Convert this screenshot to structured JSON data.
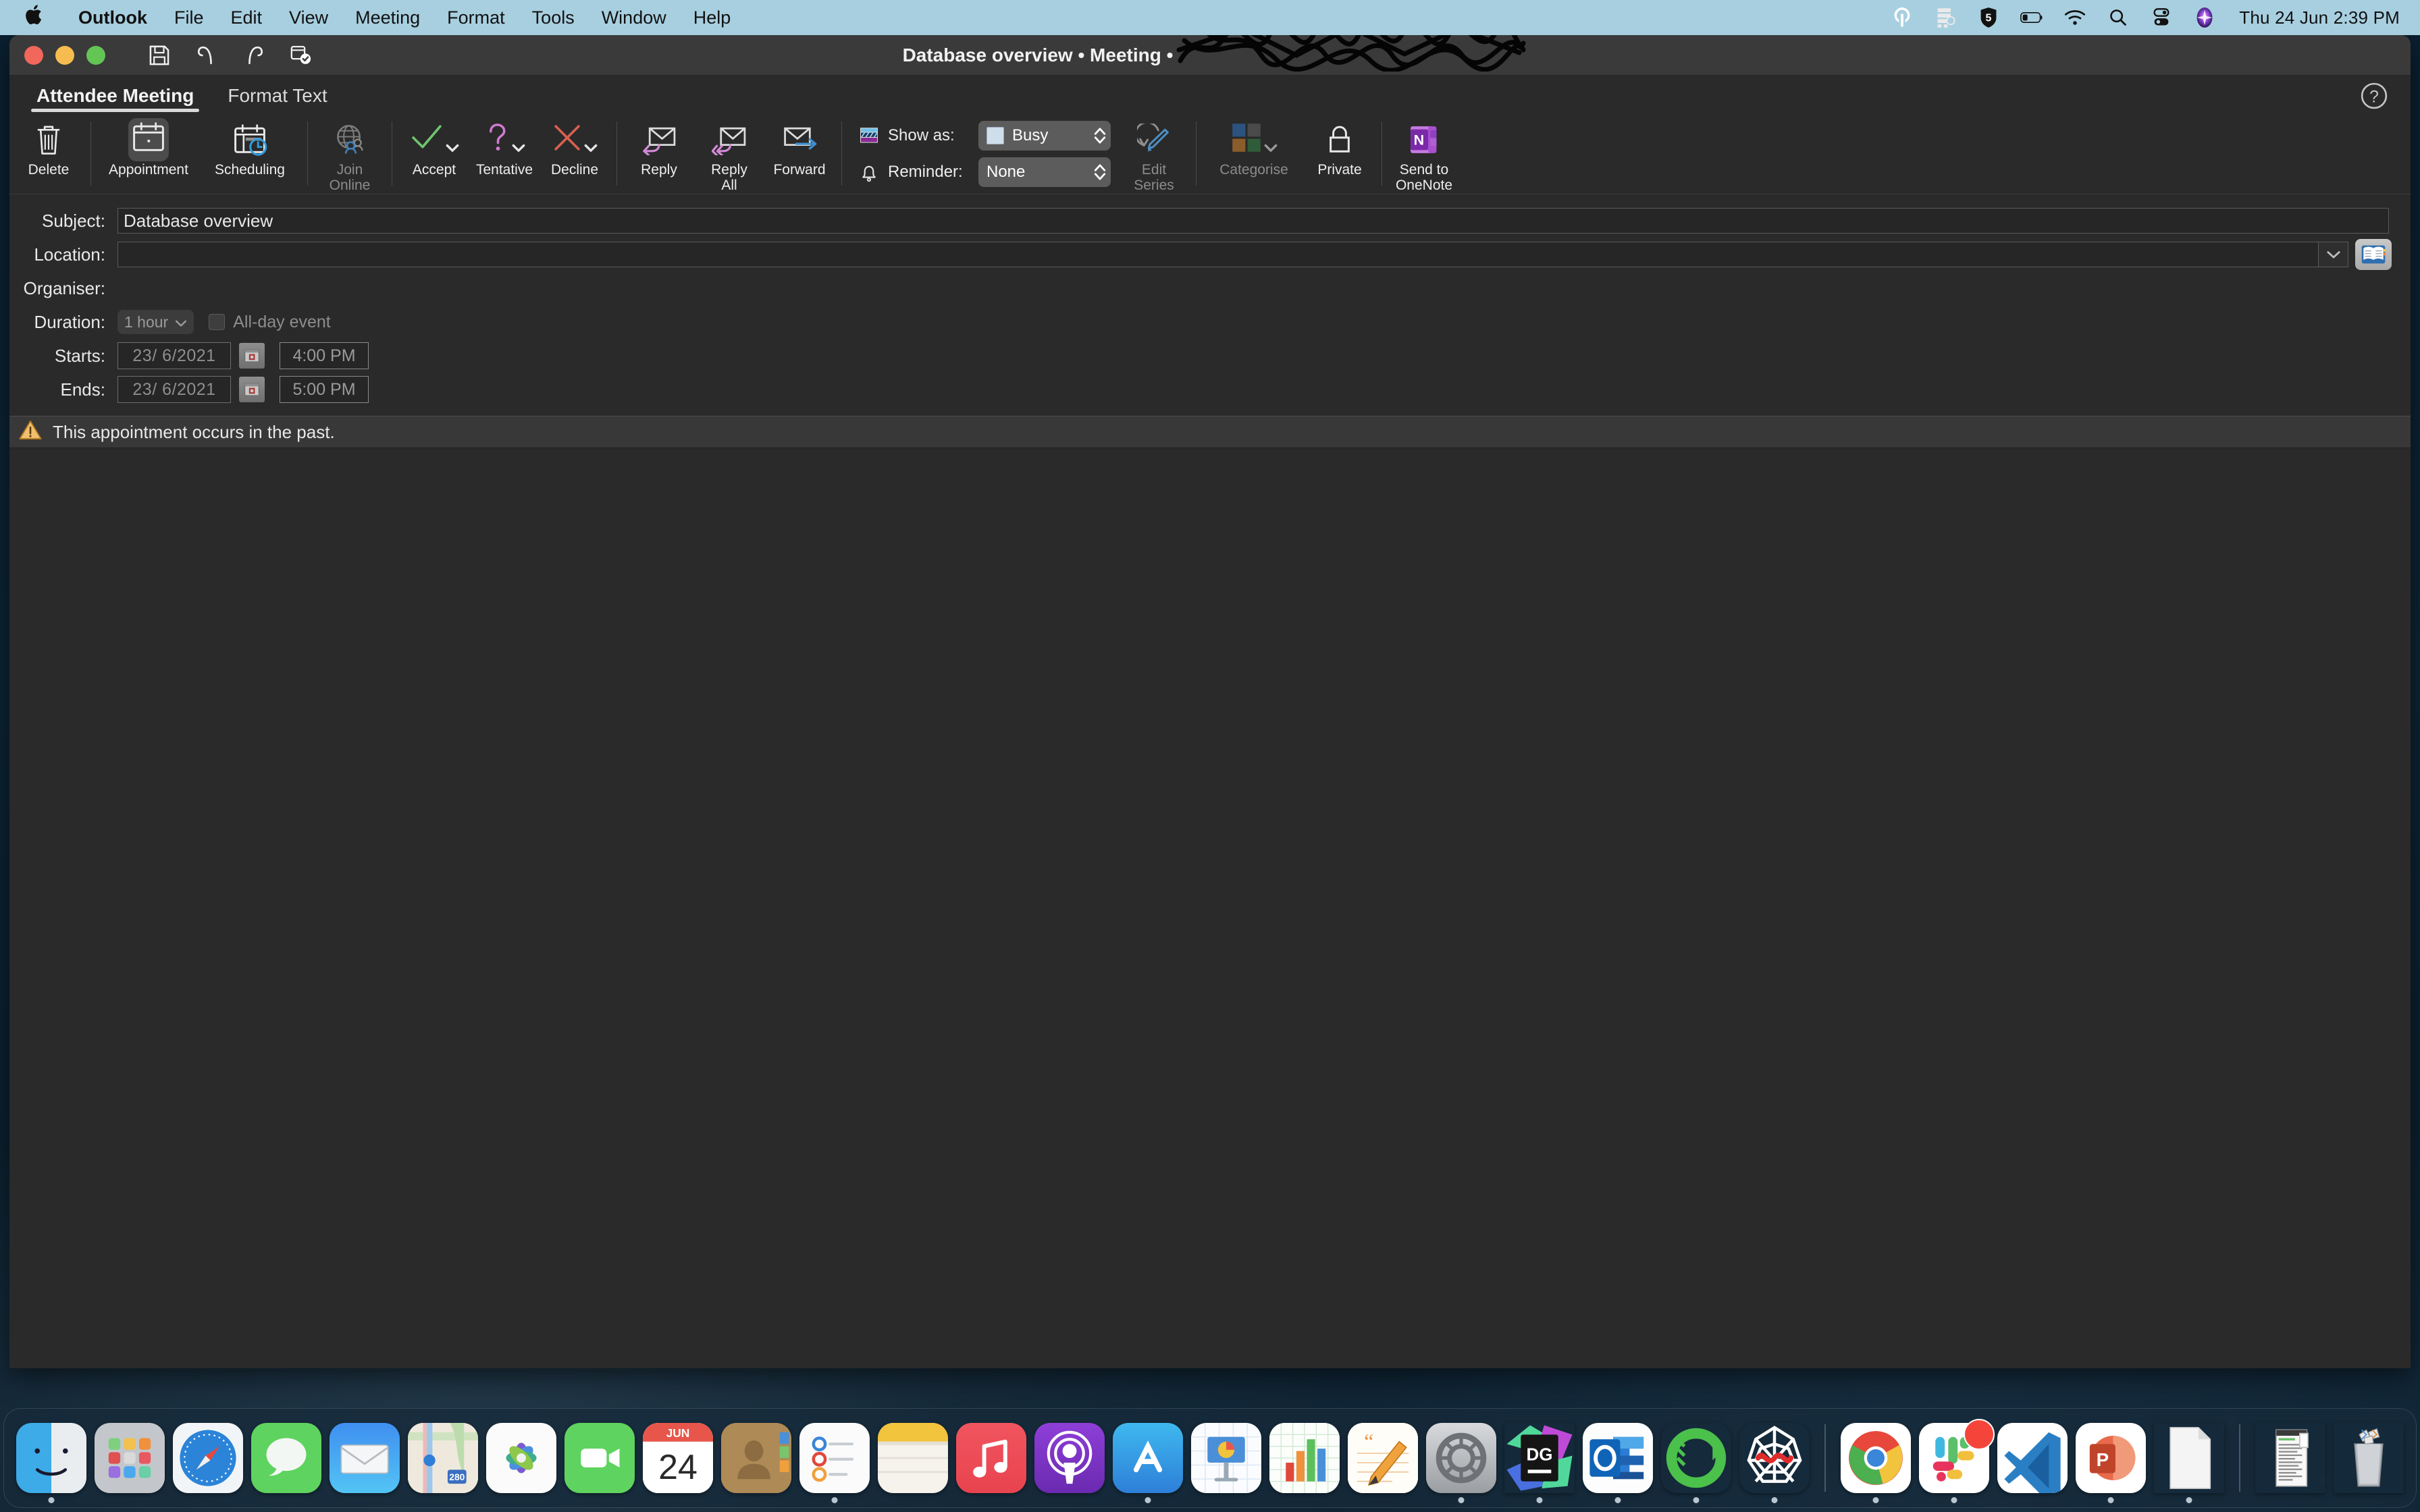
{
  "menubar": {
    "apple_icon": "apple-logo-icon",
    "items": [
      {
        "label": "Outlook",
        "bold": true
      },
      {
        "label": "File"
      },
      {
        "label": "Edit"
      },
      {
        "label": "View"
      },
      {
        "label": "Meeting"
      },
      {
        "label": "Format"
      },
      {
        "label": "Tools"
      },
      {
        "label": "Window"
      },
      {
        "label": "Help"
      }
    ],
    "status_icons": [
      "openvpn-icon",
      "server-stack-icon",
      "shield-5-icon",
      "battery-icon",
      "wifi-icon",
      "spotlight-search-icon",
      "control-centre-icon",
      "siri-icon"
    ],
    "clock": "Thu 24 Jun  2:39 PM"
  },
  "window": {
    "title_visible": "Database overview • Meeting • ",
    "title_redacted": true,
    "traffic_lights": [
      "close",
      "minimise",
      "zoom"
    ],
    "toolbar_icons": [
      "save-icon",
      "undo-icon",
      "redo-icon",
      "send-status-icon"
    ]
  },
  "tabs": [
    {
      "label": "Attendee Meeting",
      "active": true
    },
    {
      "label": "Format Text",
      "active": false
    }
  ],
  "help_button": "help-icon",
  "ribbon": {
    "delete": {
      "label": "Delete",
      "icon": "trash-icon"
    },
    "appointment": {
      "label": "Appointment",
      "icon": "calendar-icon",
      "selected": true
    },
    "scheduling": {
      "label": "Scheduling",
      "icon": "calendar-clock-icon"
    },
    "join_online": {
      "label": "Join\nOnline",
      "label_l1": "Join",
      "label_l2": "Online",
      "icon": "globe-person-icon",
      "disabled": true
    },
    "accept": {
      "label": "Accept",
      "icon": "check-icon",
      "color": "#6ec46e"
    },
    "tentative": {
      "label": "Tentative",
      "icon": "question-icon",
      "color": "#d17ad1"
    },
    "decline": {
      "label": "Decline",
      "icon": "cross-icon",
      "color": "#d9604f"
    },
    "reply": {
      "label": "Reply",
      "icon": "reply-envelope-icon",
      "color": "#d28ad6"
    },
    "reply_all": {
      "label_l1": "Reply",
      "label_l2": "All",
      "icon": "reply-all-envelope-icon",
      "color": "#d28ad6"
    },
    "forward": {
      "label": "Forward",
      "icon": "forward-envelope-icon",
      "color": "#3f8fd0"
    },
    "show_as": {
      "label": "Show as:",
      "value": "Busy",
      "icon": "show-as-icon",
      "swatch_color": "#cfdeeb"
    },
    "reminder": {
      "label": "Reminder:",
      "value": "None",
      "icon": "bell-icon"
    },
    "edit_series": {
      "label_l1": "Edit",
      "label_l2": "Series",
      "icon": "edit-series-icon",
      "disabled": true
    },
    "categorise": {
      "label": "Categorise",
      "icon": "categories-grid-icon",
      "disabled": true,
      "colors": [
        "#2c537f",
        "#4a4a4a",
        "#8a5d2a",
        "#2f5c39"
      ]
    },
    "private": {
      "label": "Private",
      "icon": "padlock-icon"
    },
    "send_to_onenote": {
      "label_l1": "Send to",
      "label_l2": "OneNote",
      "icon": "onenote-icon"
    }
  },
  "form": {
    "subject": {
      "label": "Subject:",
      "value": "Database overview"
    },
    "location": {
      "label": "Location:",
      "value": "",
      "dropdown_icon": "chevron-down-icon",
      "rooms_icon": "address-book-icon"
    },
    "organiser": {
      "label": "Organiser:",
      "value_redacted": true,
      "value": ""
    },
    "duration": {
      "label": "Duration:",
      "value": "1 hour",
      "allday_label": "All-day event",
      "allday_checked": false
    },
    "starts": {
      "label": "Starts:",
      "date": "23/  6/2021",
      "time": "4:00 PM",
      "calendar_icon": "calendar-picker-icon"
    },
    "ends": {
      "label": "Ends:",
      "date": "23/  6/2021",
      "time": "5:00 PM",
      "calendar_icon": "calendar-picker-icon"
    }
  },
  "warning": {
    "icon": "warning-triangle-icon",
    "text": "This appointment occurs in the past."
  },
  "dock": {
    "items": [
      {
        "name": "finder",
        "running": true
      },
      {
        "name": "launchpad",
        "running": false
      },
      {
        "name": "safari",
        "running": false
      },
      {
        "name": "messages",
        "running": false
      },
      {
        "name": "mail",
        "running": false
      },
      {
        "name": "maps",
        "running": false
      },
      {
        "name": "photos",
        "running": false
      },
      {
        "name": "facetime",
        "running": false
      },
      {
        "name": "calendar",
        "running": false,
        "month": "JUN",
        "day": "24"
      },
      {
        "name": "contacts",
        "running": false
      },
      {
        "name": "reminders",
        "running": true
      },
      {
        "name": "notes",
        "running": false
      },
      {
        "name": "music",
        "running": false
      },
      {
        "name": "podcasts",
        "running": false
      },
      {
        "name": "app-store",
        "running": true
      },
      {
        "name": "keynote",
        "running": false
      },
      {
        "name": "numbers",
        "running": false
      },
      {
        "name": "pages",
        "running": false
      },
      {
        "name": "system-preferences",
        "running": true
      },
      {
        "name": "datagrip",
        "running": true,
        "label": "DG"
      },
      {
        "name": "outlook",
        "running": true
      },
      {
        "name": "mongodb-compass",
        "running": true
      },
      {
        "name": "spyder",
        "running": false
      },
      {
        "name": "chrome",
        "running": true
      },
      {
        "name": "slack",
        "running": true,
        "badge": true
      },
      {
        "name": "visual-studio-code",
        "running": false
      },
      {
        "name": "powerpoint",
        "running": true
      },
      {
        "name": "document",
        "running": true
      }
    ],
    "right_items": [
      {
        "name": "downloads-stack"
      },
      {
        "name": "trash"
      }
    ]
  }
}
